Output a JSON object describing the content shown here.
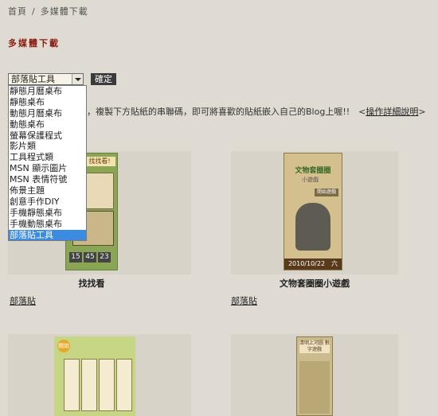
{
  "breadcrumb": {
    "home": "首頁",
    "separator": "/",
    "current": "多媒體下載"
  },
  "page_title": "多媒體下載",
  "filter": {
    "selected": "部落貼工具",
    "confirm_label": "確定",
    "options": [
      "靜態月曆桌布",
      "靜態桌布",
      "動態月曆桌布",
      "動態桌布",
      "螢幕保護程式",
      "影片類",
      "工具程式類",
      "MSN 顯示圖片",
      "MSN 表情符號",
      "佈景主題",
      "創意手作DIY",
      "手機靜態桌布",
      "手機動態桌布",
      "部落貼工具"
    ]
  },
  "instructions": {
    "text": "紙，複製下方貼紙的串聯碼，即可將喜歡的貼紙嵌入自己的Blog上喔!!　<",
    "link": "操作詳細說明",
    "suffix": ">"
  },
  "items": [
    {
      "caption": "找找看",
      "category": "部落貼",
      "widget_title": "找找看!",
      "clock": [
        "15",
        "45",
        "23"
      ]
    },
    {
      "caption": "文物套圈圈小遊戲",
      "category": "部落貼",
      "widget_title": "文物套圈圈",
      "widget_sub": "小遊戲",
      "widget_start": "開始遊戲",
      "widget_date": "2010/10/22　六"
    },
    {
      "widget_badge": "開始"
    },
    {
      "widget_title": "清明上河圖 數字遊戲"
    }
  ]
}
